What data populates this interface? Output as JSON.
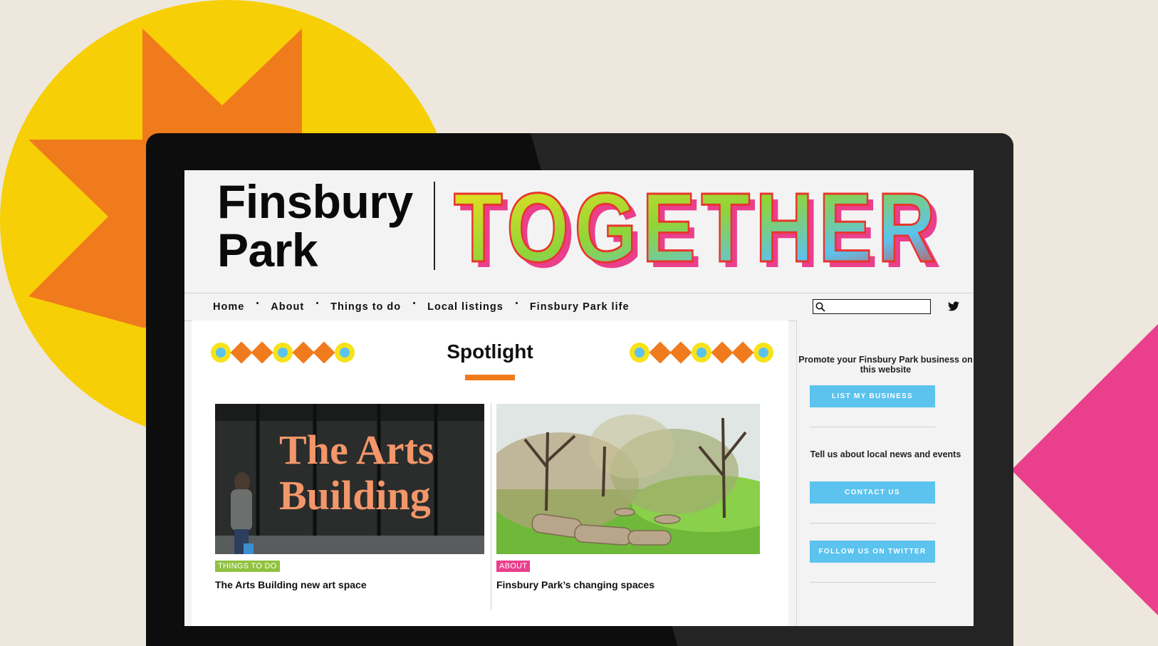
{
  "site": {
    "title_line1": "Finsbury",
    "title_line2": "Park",
    "title_word": "TOGETHER"
  },
  "nav": {
    "items": [
      "Home",
      "About",
      "Things to do",
      "Local listings",
      "Finsbury Park life"
    ],
    "search_placeholder": ""
  },
  "main": {
    "heading": "Spotlight",
    "cards": [
      {
        "image_text_line1": "The Arts",
        "image_text_line2": "Building",
        "tag": "THINGS TO DO",
        "title": "The Arts Building new art space"
      },
      {
        "tag": "ABOUT",
        "title": "Finsbury Park’s changing spaces"
      }
    ]
  },
  "sidebar": {
    "promo_text": "Promote your Finsbury Park business on this website",
    "list_button": "LIST MY BUSINESS",
    "news_text": "Tell us about local news and events",
    "contact_button": "CONTACT US",
    "twitter_button": "FOLLOW US ON TWITTER"
  },
  "colors": {
    "yellow": "#f7cf06",
    "orange": "#f07b1c",
    "pink": "#ea3f8d",
    "blue": "#5bc3ee",
    "green": "#8fc240"
  }
}
